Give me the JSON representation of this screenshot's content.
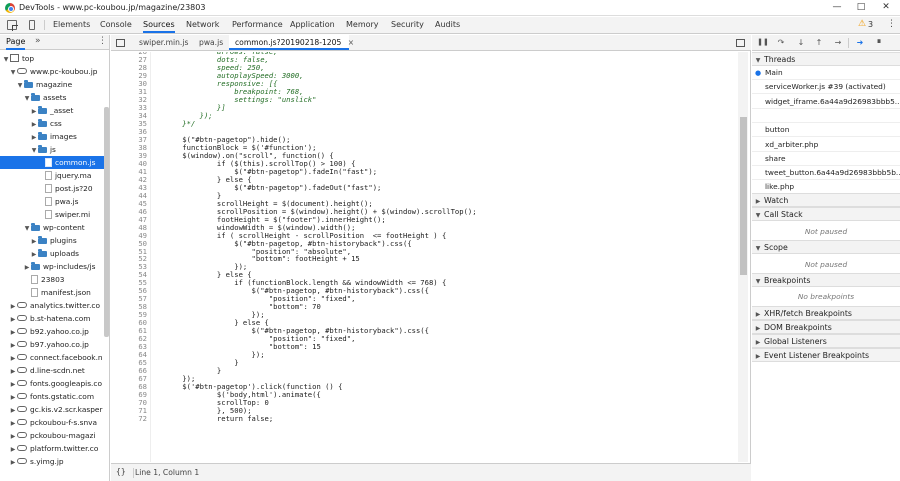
{
  "window": {
    "title": "DevTools - www.pc-koubou.jp/magazine/23803"
  },
  "main_tabs": [
    "Elements",
    "Console",
    "Sources",
    "Network",
    "Performance",
    "Application",
    "Memory",
    "Security",
    "Audits"
  ],
  "active_main_tab": "Sources",
  "warning_count": "3",
  "navigator": {
    "tab": "Page",
    "more": "»",
    "tree": [
      {
        "label": "top",
        "kind": "frame",
        "depth": 0,
        "open": true
      },
      {
        "label": "www.pc-koubou.jp",
        "kind": "cloud",
        "depth": 1,
        "open": true
      },
      {
        "label": "magazine",
        "kind": "folder",
        "depth": 2,
        "open": true
      },
      {
        "label": "assets",
        "kind": "folder",
        "depth": 3,
        "open": true
      },
      {
        "label": "_asset",
        "kind": "folder",
        "depth": 4,
        "open": false
      },
      {
        "label": "css",
        "kind": "folder",
        "depth": 4,
        "open": false
      },
      {
        "label": "images",
        "kind": "folder",
        "depth": 4,
        "open": false
      },
      {
        "label": "js",
        "kind": "folder",
        "depth": 4,
        "open": true
      },
      {
        "label": "common.js",
        "kind": "file",
        "depth": 5,
        "selected": true
      },
      {
        "label": "jquery.ma",
        "kind": "file",
        "depth": 5
      },
      {
        "label": "post.js?20",
        "kind": "file",
        "depth": 5
      },
      {
        "label": "pwa.js",
        "kind": "file",
        "depth": 5
      },
      {
        "label": "swiper.mi",
        "kind": "file",
        "depth": 5
      },
      {
        "label": "wp-content",
        "kind": "folder",
        "depth": 3,
        "open": true
      },
      {
        "label": "plugins",
        "kind": "folder",
        "depth": 4,
        "open": false
      },
      {
        "label": "uploads",
        "kind": "folder",
        "depth": 4,
        "open": false
      },
      {
        "label": "wp-includes/js",
        "kind": "folder",
        "depth": 3,
        "open": false
      },
      {
        "label": "23803",
        "kind": "file",
        "depth": 3
      },
      {
        "label": "manifest.json",
        "kind": "file",
        "depth": 3
      },
      {
        "label": "analytics.twitter.co",
        "kind": "cloud",
        "depth": 1,
        "open": false
      },
      {
        "label": "b.st-hatena.com",
        "kind": "cloud",
        "depth": 1,
        "open": false
      },
      {
        "label": "b92.yahoo.co.jp",
        "kind": "cloud",
        "depth": 1,
        "open": false
      },
      {
        "label": "b97.yahoo.co.jp",
        "kind": "cloud",
        "depth": 1,
        "open": false
      },
      {
        "label": "connect.facebook.n",
        "kind": "cloud",
        "depth": 1,
        "open": false
      },
      {
        "label": "d.line-scdn.net",
        "kind": "cloud",
        "depth": 1,
        "open": false
      },
      {
        "label": "fonts.googleapis.co",
        "kind": "cloud",
        "depth": 1,
        "open": false
      },
      {
        "label": "fonts.gstatic.com",
        "kind": "cloud",
        "depth": 1,
        "open": false
      },
      {
        "label": "gc.kis.v2.scr.kasper",
        "kind": "cloud",
        "depth": 1,
        "open": false
      },
      {
        "label": "pckoubou-f-s.snva",
        "kind": "cloud",
        "depth": 1,
        "open": false
      },
      {
        "label": "pckoubou-magazi",
        "kind": "cloud",
        "depth": 1,
        "open": false
      },
      {
        "label": "platform.twitter.co",
        "kind": "cloud",
        "depth": 1,
        "open": false
      },
      {
        "label": "s.yimg.jp",
        "kind": "cloud",
        "depth": 1,
        "open": false
      }
    ]
  },
  "editor": {
    "tabs": [
      "swiper.min.js",
      "pwa.js",
      "common.js?20190218-1205"
    ],
    "active_tab": 2,
    "close_glyph": "×",
    "status": "Line 1, Column 1",
    "format_glyph": "{}",
    "first_line": 26,
    "lines": [
      "            arrows: false,",
      "            dots: false,",
      "            speed: 250,",
      "            autoplaySpeed: 3000,",
      "            responsive: [{",
      "                breakpoint: 768,",
      "                settings: \"unslick\"",
      "            }]",
      "        });",
      "    }*/",
      "",
      "    $(\"#btn-pagetop\").hide();",
      "    functionBlock = $('#function');",
      "    $(window).on(\"scroll\", function() {",
      "            if ($(this).scrollTop() > 100) {",
      "                $(\"#btn-pagetop\").fadeIn(\"fast\");",
      "            } else {",
      "                $(\"#btn-pagetop\").fadeOut(\"fast\");",
      "            }",
      "            scrollHeight = $(document).height();",
      "            scrollPosition = $(window).height() + $(window).scrollTop();",
      "            footHeight = $(\"footer\").innerHeight();",
      "            windowWidth = $(window).width();",
      "            if ( scrollHeight - scrollPosition  <= footHeight ) {",
      "                $(\"#btn-pagetop, #btn-historyback\").css({",
      "                    \"position\": \"absolute\",",
      "                    \"bottom\": footHeight + 15",
      "                });",
      "            } else {",
      "                if (functionBlock.length && windowWidth <= 768) {",
      "                    $(\"#btn-pagetop, #btn-historyback\").css({",
      "                        \"position\": \"fixed\",",
      "                        \"bottom\": 70",
      "                    });",
      "                } else {",
      "                    $(\"#btn-pagetop, #btn-historyback\").css({",
      "                        \"position\": \"fixed\",",
      "                        \"bottom\": 15",
      "                    });",
      "                }",
      "            }",
      "    });",
      "    $('#btn-pagetop').click(function () {",
      "            $('body,html').animate({",
      "            scrollTop: 0",
      "            }, 500);",
      "            return false;"
    ]
  },
  "debugger": {
    "threads_label": "Threads",
    "threads": [
      {
        "name": "Main",
        "current": true
      },
      {
        "name": "serviceWorker.js #39 (activated)",
        "current": false
      },
      {
        "name": "widget_iframe.6a44a9d26983bbb5...",
        "current": false
      },
      {
        "name": "",
        "current": false
      },
      {
        "name": "button",
        "current": false
      },
      {
        "name": "xd_arbiter.php",
        "current": false
      },
      {
        "name": "share",
        "current": false
      },
      {
        "name": "tweet_button.6a44a9d26983bbb5b...",
        "current": false
      },
      {
        "name": "like.php",
        "current": false
      }
    ],
    "watch_label": "Watch",
    "callstack_label": "Call Stack",
    "callstack_note": "Not paused",
    "scope_label": "Scope",
    "scope_note": "Not paused",
    "breakpoints_label": "Breakpoints",
    "breakpoints_note": "No breakpoints",
    "xhr_label": "XHR/fetch Breakpoints",
    "dom_label": "DOM Breakpoints",
    "global_label": "Global Listeners",
    "event_label": "Event Listener Breakpoints"
  },
  "colors": {
    "accent": "#1a73e8",
    "comment": "#236e25",
    "folder": "#3b82c4",
    "warning": "#f29900"
  }
}
